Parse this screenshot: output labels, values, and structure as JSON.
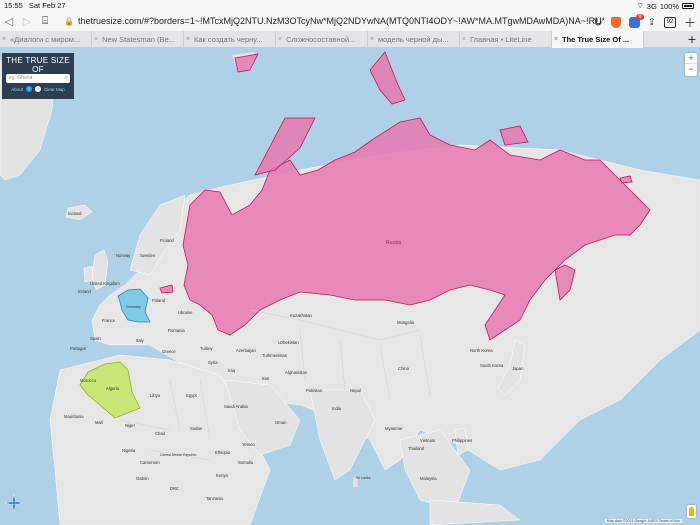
{
  "status_bar": {
    "time": "15:55",
    "date": "Sat Feb 27",
    "signal": "3G",
    "battery": "100%"
  },
  "toolbar": {
    "url": "thetruesize.com/#?borders=1~!MTcxMjQ2NTU.NzM3OTcyNw*MjQ2NDYwNA(MTQ0NTI4ODY~!AW*MA.MTgwMDAwMDA)NA~!RU*Mz...",
    "tab_count": "92"
  },
  "tabs": [
    {
      "label": "«Диалоги с миром...",
      "active": false
    },
    {
      "label": "New Statesman (Be...",
      "active": false
    },
    {
      "label": "Как создать черну...",
      "active": false
    },
    {
      "label": "Сложносоставной...",
      "active": false
    },
    {
      "label": "модель черной ды...",
      "active": false
    },
    {
      "label": "Главная • LiteLine",
      "active": false
    },
    {
      "label": "The True Size Of ...",
      "active": true
    }
  ],
  "panel": {
    "title": "THE TRUE SIZE OF",
    "subtitle": "...",
    "search_placeholder": "eg. Ghana",
    "link_about": "About",
    "link_clear": "Clear Map"
  },
  "zoom": {
    "in": "+",
    "out": "−"
  },
  "attribution": "Map data ©2021 Google, INEGI   Terms of Use",
  "highlighted": [
    {
      "name": "Russia",
      "color": "#e879b0"
    },
    {
      "name": "Germany",
      "color": "#6ec6e8"
    },
    {
      "name": "Algeria",
      "color": "#c8e66a"
    }
  ],
  "map_labels": {
    "russia": "Russia",
    "germany": "Germany",
    "algeria": "Algeria",
    "kazakhstan": "Kazakhstan",
    "mongolia": "Mongolia",
    "china": "China",
    "india": "India",
    "iran": "Iran",
    "saudi": "Saudi Arabia",
    "turkey": "Turkey",
    "egypt": "Egypt",
    "libya": "Libya",
    "mali": "Mali",
    "niger": "Niger",
    "chad": "Chad",
    "sudan": "Sudan",
    "nigeria": "Nigeria",
    "ethiopia": "Ethiopia",
    "morocco": "Morocco",
    "mauritania": "Mauritania",
    "japan": "Japan",
    "pakistan": "Pakistan",
    "afghanistan": "Afghanistan",
    "uzbek": "Uzbekistan",
    "turkmen": "Turkmenistan",
    "thailand": "Thailand",
    "myanmar": "Myanmar",
    "philippines": "Philippines",
    "vietnam": "Vietnam",
    "iceland": "Iceland",
    "uk": "United Kingdom",
    "ireland": "Ireland",
    "spain": "Spain",
    "portugal": "Portugal",
    "france": "France",
    "italy": "Italy",
    "poland": "Poland",
    "ukraine": "Ukraine",
    "finland": "Finland",
    "sweden": "Sweden",
    "norway": "Norway",
    "skorea": "South Korea",
    "nkorea": "North Korea",
    "greece": "Greece",
    "romania": "Romania",
    "yemen": "Yemen",
    "oman": "Oman",
    "drc": "DRC",
    "kenya": "Kenya",
    "somalia": "Somalia",
    "iraq": "Iraq",
    "syria": "Syria",
    "azer": "Azerbaijan",
    "cameroon": "Cameroon",
    "car": "Central African Republic",
    "gabon": "Gabon",
    "tanzania": "Tanzania",
    "malaysia": "Malaysia",
    "sri": "Sri Lanka",
    "nepal": "Nepal"
  }
}
